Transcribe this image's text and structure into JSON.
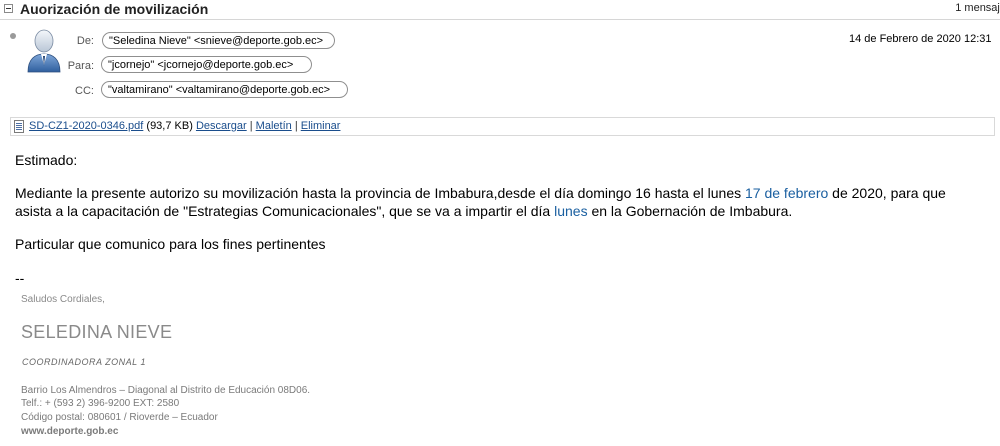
{
  "header": {
    "subject": "Auorización de movilización",
    "count": "1 mensaje",
    "from_label": "De:",
    "to_label": "Para:",
    "cc_label": "CC:",
    "from": "\"Seledina Nieve\" <snieve@deporte.gob.ec>",
    "to": "\"jcornejo\" <jcornejo@deporte.gob.ec>",
    "cc": "\"valtamirano\" <valtamirano@deporte.gob.ec>",
    "date": "14 de Febrero de 2020 12:31"
  },
  "attachment": {
    "filename": "SD-CZ1-2020-0346.pdf",
    "size": "(93,7 KB)",
    "download": "Descargar",
    "briefcase": "Maletín",
    "delete": "Eliminar",
    "sep": "|"
  },
  "body": {
    "greeting": "Estimado:",
    "p1_a": "Mediante la presente autorizo su movilización hasta la provincia de Imbabura,desde el día domingo 16 hasta el lunes ",
    "p1_link1": "17 de febrero",
    "p1_b": " de 2020,  para que",
    "p2_a": "asista a la capacitación de \"Estrategias Comunicacionales\", que se va a impartir el día ",
    "p2_link2": "lunes",
    "p2_b": " en la Gobernación de Imbabura.",
    "closing": "Particular que comunico para los fines pertinentes",
    "dashes": "--"
  },
  "signature": {
    "greeting": "Saludos Cordiales,",
    "name": "SELEDINA NIEVE",
    "role": "COORDINADORA ZONAL 1",
    "address": "Barrio Los Almendros – Diagonal al Distrito de Educación 08D06.",
    "phone": "Telf.: + (593 2) 396-9200 EXT: 2580",
    "postal": "Código postal: 080601 / Rioverde – Ecuador",
    "web": "www.deporte.gob.ec"
  }
}
